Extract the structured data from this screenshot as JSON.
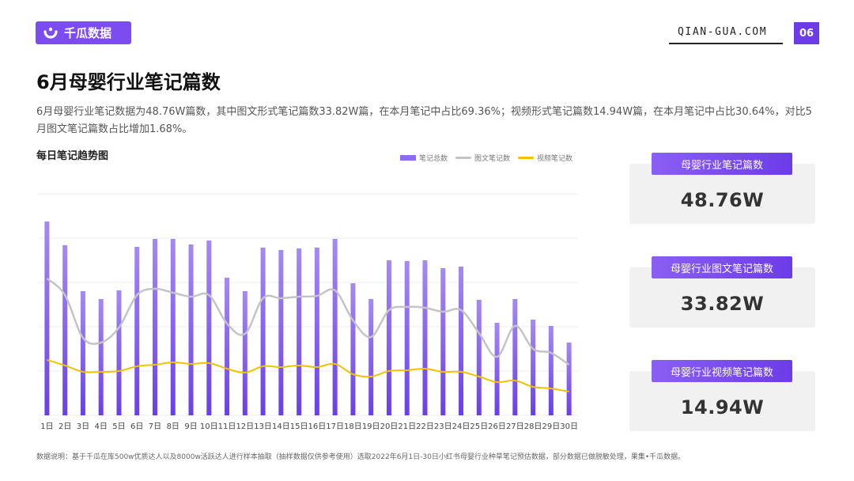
{
  "header": {
    "logo_text": "千瓜数据",
    "site": "QIAN-GUA.COM",
    "page_number": "06",
    "brand_color": "#6c3ce8"
  },
  "title": "6月母婴行业笔记篇数",
  "description": "6月母婴行业笔记数据为48.76W篇数，其中图文形式笔记篇数33.82W篇，在本月笔记中占比69.36%；视频形式笔记篇数14.94W篇，在本月笔记中占比30.64%，对比5月图文笔记篇数占比增加1.68%。",
  "chart_title": "每日笔记趋势图",
  "cards": [
    {
      "label": "母婴行业笔记篇数",
      "value": "48.76W"
    },
    {
      "label": "母婴行业图文笔记篇数",
      "value": "33.82W"
    },
    {
      "label": "母婴行业视频笔记篇数",
      "value": "14.94W"
    }
  ],
  "footnote": "数据说明：基于千瓜在库500w优质达人以及8000w活跃达人进行样本抽取（抽样数据仅供参考使用）选取2022年6月1日-30日小红书母婴行业种草笔记预估数据，部分数据已做脱敏处理，果集•千瓜数据。",
  "chart_data": {
    "type": "bar",
    "categories": [
      "1日",
      "2日",
      "3日",
      "4日",
      "5日",
      "6日",
      "7日",
      "8日",
      "9日",
      "10日",
      "11日",
      "12日",
      "13日",
      "14日",
      "15日",
      "16日",
      "17日",
      "18日",
      "19日",
      "20日",
      "21日",
      "22日",
      "23日",
      "24日",
      "25日",
      "26日",
      "27日",
      "28日",
      "29日",
      "30日"
    ],
    "series": [
      {
        "name": "笔记总数",
        "kind": "bar",
        "color": "#7b55ee",
        "values": [
          245,
          215,
          157,
          147,
          158,
          213,
          223,
          223,
          216,
          221,
          174,
          157,
          212,
          209,
          211,
          212,
          223,
          167,
          147,
          196,
          195,
          196,
          186,
          188,
          146,
          117,
          147,
          121,
          113,
          92
        ]
      },
      {
        "name": "图文笔记数",
        "kind": "line",
        "color": "#c4c4c4",
        "values": [
          173,
          152,
          98,
          92,
          111,
          152,
          160,
          155,
          150,
          152,
          116,
          103,
          148,
          148,
          150,
          151,
          158,
          120,
          99,
          133,
          137,
          136,
          131,
          133,
          104,
          74,
          113,
          84,
          79,
          64
        ]
      },
      {
        "name": "视频笔记数",
        "kind": "line",
        "color": "#f2c200",
        "values": [
          70,
          63,
          55,
          55,
          56,
          62,
          64,
          67,
          65,
          66,
          59,
          54,
          62,
          61,
          63,
          61,
          65,
          52,
          49,
          56,
          57,
          59,
          55,
          55,
          49,
          42,
          44,
          36,
          34,
          30
        ]
      }
    ],
    "ylim": [
      0,
      280
    ],
    "grid": true,
    "legend": "top-right"
  }
}
